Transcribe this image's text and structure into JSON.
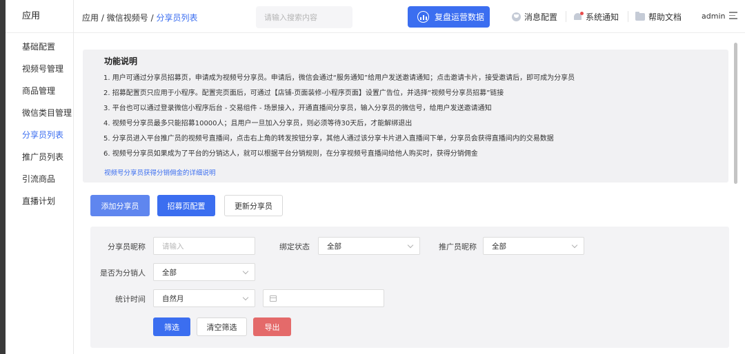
{
  "sidebar": {
    "app_title": "应用",
    "items": [
      {
        "label": "基础配置",
        "active": false
      },
      {
        "label": "视频号管理",
        "active": false
      },
      {
        "label": "商品管理",
        "active": false
      },
      {
        "label": "微信类目管理",
        "active": false
      },
      {
        "label": "分享员列表",
        "active": true
      },
      {
        "label": "推广员列表",
        "active": false
      },
      {
        "label": "引流商品",
        "active": false
      },
      {
        "label": "直播计划",
        "active": false
      }
    ]
  },
  "header": {
    "breadcrumb": {
      "level1": "应用",
      "sep": "/",
      "level2": "微信视频号",
      "current": "分享员列表"
    },
    "search_placeholder": "请输入搜索内容",
    "ops_button": "复盘运营数据",
    "links": {
      "messages": "消息配置",
      "notifications": "系统通知",
      "help": "帮助文档"
    },
    "user": "admin"
  },
  "info": {
    "title": "功能说明",
    "lines": [
      "1. 用户可通过分享员招募页，申请成为视频号分享员。申请后，微信会通过“服务通知”给用户发送邀请通知；点击邀请卡片，接受邀请后，即可成为分享员",
      "2. 招募配置页只应用于小程序。配置完页面后，可通过【店铺-页面装修-小程序页面】设置广告位，并选择“视频号分享员招募”链接",
      "3. 平台也可以通过登录微信小程序后台 - 交易组件 - 场景接入，开通直播间分享员，输入分享员的微信号，给用户发送邀请通知",
      "4. 视频号分享员最多只能招募10000人；且用户一旦加入分享员，则必须等待30天后，才能解绑退出",
      "5. 分享员进入平台推广员的视频号直播间，点击右上角的转发按钮分享，其他人通过该分享卡片进入直播间下单，分享员会获得直播间内的交易数据",
      "6. 视频号分享员如果成为了平台的分销达人，就可以根据平台分销规则，在分享视频号直播间给他人购买时，获得分销佣金"
    ],
    "link": "视频号分享员获得分销佣金的详细说明"
  },
  "actions": {
    "add": "添加分享员",
    "recruit": "招募页配置",
    "update": "更新分享员"
  },
  "filters": {
    "sharer_nickname": {
      "label": "分享员昵称",
      "placeholder": "请输入"
    },
    "bind_status": {
      "label": "绑定状态",
      "value": "全部"
    },
    "promoter_nickname": {
      "label": "推广员昵称",
      "value": "全部"
    },
    "is_distributor": {
      "label": "是否为分销人",
      "value": "全部"
    },
    "stat_time": {
      "label": "统计时间",
      "value": "自然月",
      "date_value": ""
    },
    "buttons": {
      "filter": "筛选",
      "clear": "清空筛选",
      "export": "导出"
    }
  },
  "colors": {
    "primary": "#3b6ef0",
    "danger": "#e46a6a",
    "panel": "#f1f1f3"
  }
}
